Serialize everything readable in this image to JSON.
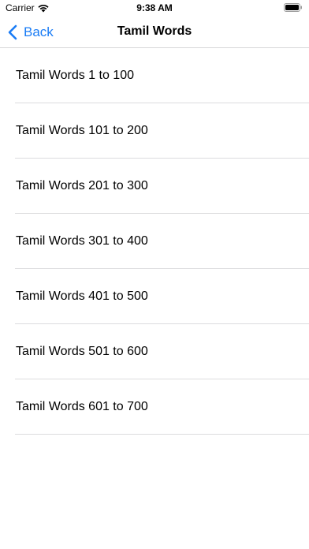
{
  "status_bar": {
    "carrier": "Carrier",
    "time": "9:38 AM",
    "wifi_icon": "wifi-icon",
    "battery_icon": "battery-icon"
  },
  "nav": {
    "back_label": "Back",
    "title": "Tamil Words",
    "accent_color": "#1a7cf5"
  },
  "list": {
    "items": [
      {
        "label": "Tamil Words 1 to 100"
      },
      {
        "label": "Tamil Words 101 to 200"
      },
      {
        "label": "Tamil Words 201 to 300"
      },
      {
        "label": "Tamil Words 301 to 400"
      },
      {
        "label": "Tamil Words 401 to 500"
      },
      {
        "label": "Tamil Words 501 to 600"
      },
      {
        "label": "Tamil Words 601 to 700"
      }
    ]
  }
}
